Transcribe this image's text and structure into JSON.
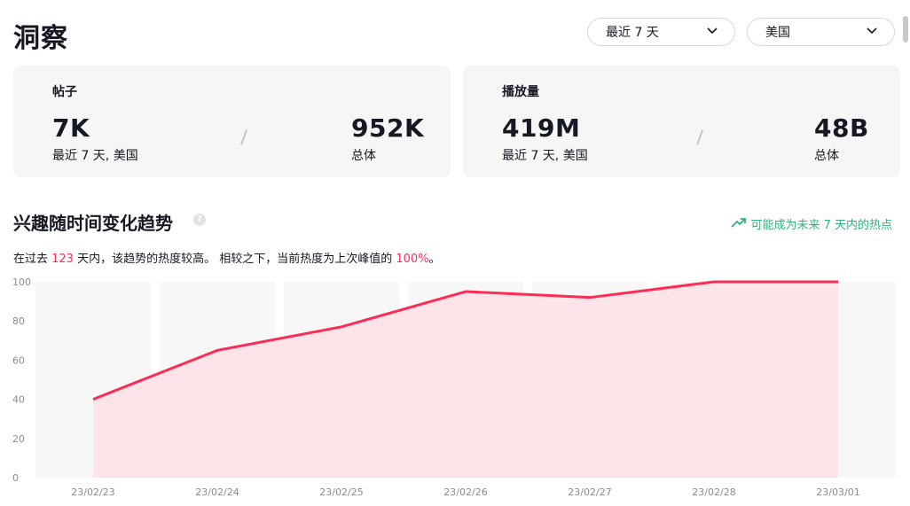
{
  "page": {
    "title": "洞察"
  },
  "filters": {
    "period": "最近 7 天",
    "region": "美国"
  },
  "cards": [
    {
      "title": "帖子",
      "recent_value": "7K",
      "recent_label": "最近 7 天, 美国",
      "total_value": "952K",
      "total_label": "总体"
    },
    {
      "title": "播放量",
      "recent_value": "419M",
      "recent_label": "最近 7 天, 美国",
      "total_value": "48B",
      "total_label": "总体"
    }
  ],
  "trend": {
    "title": "兴趣随时间变化趋势",
    "hot_label": "可能成为未来 7 天内的热点",
    "desc_prefix": "在过去 ",
    "desc_days": "123",
    "desc_mid": " 天内，该趋势的热度较高。 相较之下，当前热度为上次峰值的 ",
    "desc_pct": "100%",
    "desc_suffix": "。"
  },
  "colors": {
    "accent": "#fe2c55",
    "area": "#fce4e8",
    "band": "#f7f7f7",
    "hot_green": "#2bb57c"
  },
  "chart_data": {
    "type": "area",
    "x": [
      "23/02/23",
      "23/02/24",
      "23/02/25",
      "23/02/26",
      "23/02/27",
      "23/02/28",
      "23/03/01"
    ],
    "y_ticks": [
      0,
      20,
      40,
      60,
      80,
      100
    ],
    "ylim": [
      0,
      100
    ],
    "series": [
      {
        "values": [
          40,
          65,
          77,
          98,
          94,
          100,
          100,
          100,
          100,
          100
        ]
      }
    ],
    "points": [
      {
        "x": "23/02/23",
        "y": 40
      },
      {
        "x": "23/02/24",
        "y": 65
      },
      {
        "x": "23/02/25",
        "y": 77
      },
      {
        "x": "23/02/26",
        "y": 95
      },
      {
        "x": "23/02/27",
        "y": 92
      },
      {
        "x": "23/02/28",
        "y": 100
      },
      {
        "x": "23/03/01",
        "y": 100
      }
    ]
  }
}
